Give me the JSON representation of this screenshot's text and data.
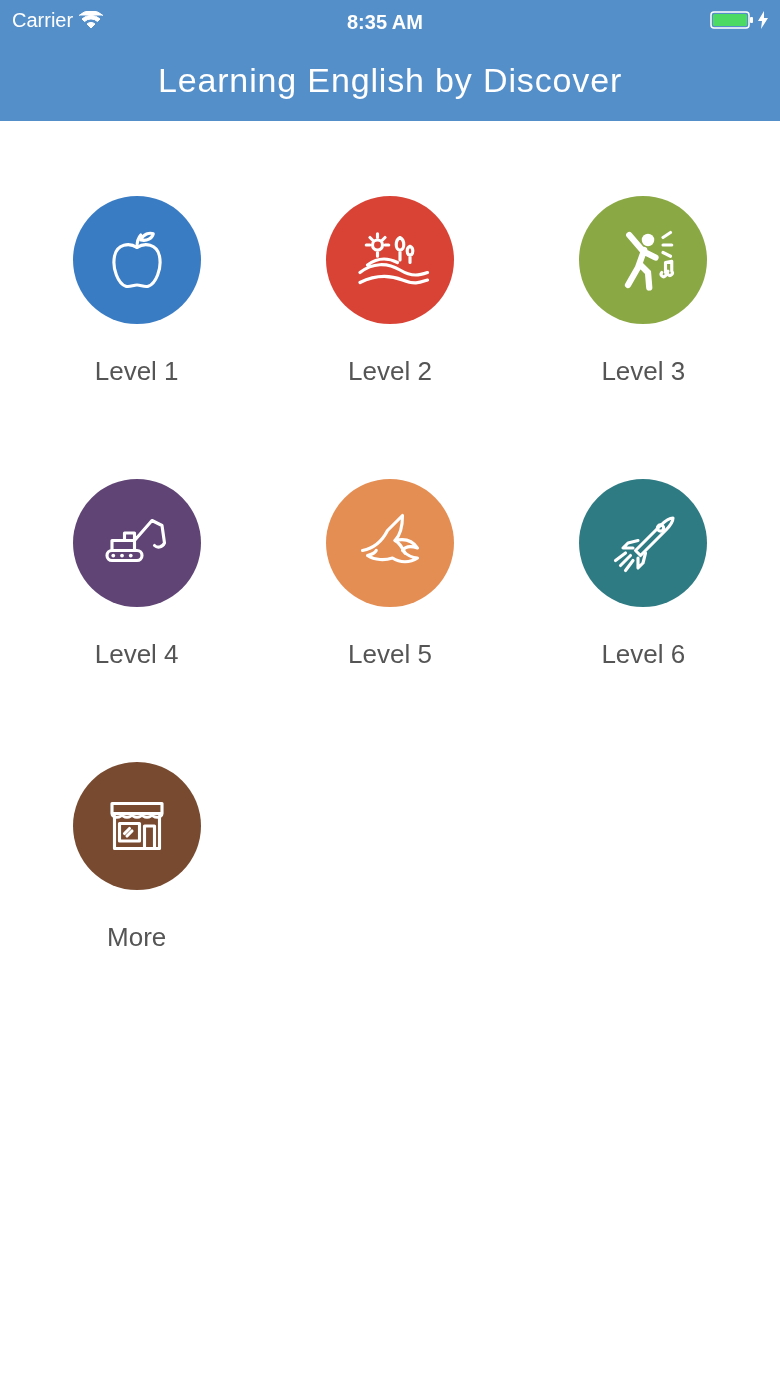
{
  "status_bar": {
    "carrier": "Carrier",
    "time": "8:35 AM"
  },
  "title": "Learning English by Discover",
  "levels": [
    {
      "label": "Level 1",
      "kind": "apple",
      "color": "#3a7cc4"
    },
    {
      "label": "Level 2",
      "kind": "landscape",
      "color": "#d94336"
    },
    {
      "label": "Level 3",
      "kind": "singer",
      "color": "#8aa844"
    },
    {
      "label": "Level 4",
      "kind": "excavator",
      "color": "#5f4475"
    },
    {
      "label": "Level 5",
      "kind": "bird",
      "color": "#e48e54"
    },
    {
      "label": "Level 6",
      "kind": "rocket",
      "color": "#2f7b83"
    },
    {
      "label": "More",
      "kind": "shop",
      "color": "#784a30"
    }
  ]
}
